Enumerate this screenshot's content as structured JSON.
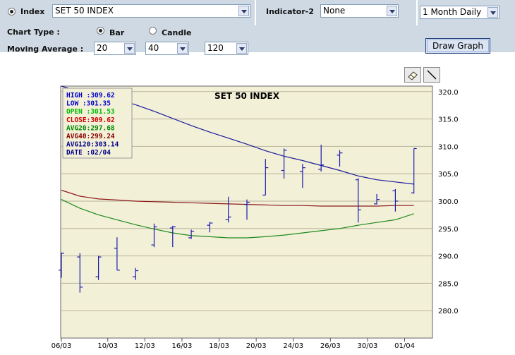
{
  "controls": {
    "index_label": "Index",
    "index_value": "SET 50 INDEX",
    "indicator_label": "Indicator-2",
    "indicator_value": "None",
    "period_value": "1 Month Daily",
    "chart_type_label": "Chart Type :",
    "bar_label": "Bar",
    "candle_label": "Candle",
    "moving_average_label": "Moving Average :",
    "ma_values": [
      "20",
      "40",
      "120"
    ],
    "draw_button": "Draw Graph"
  },
  "tools": [
    "eraser-icon",
    "line-icon"
  ],
  "info_box": [
    {
      "text": "HIGH :309.62",
      "color": "#0000cc"
    },
    {
      "text": "LOW  :301.35",
      "color": "#0000cc"
    },
    {
      "text": "OPEN :301.53",
      "color": "#00bb00"
    },
    {
      "text": "CLOSE:309.62",
      "color": "#cc0000"
    },
    {
      "text": "AVG20:297.68",
      "color": "#008800"
    },
    {
      "text": "AVG40:299.24",
      "color": "#880000"
    },
    {
      "text": "AVG120:303.14",
      "color": "#000088"
    },
    {
      "text": "DATE :02/04",
      "color": "#000088"
    }
  ],
  "chart_data": {
    "type": "bar",
    "title": "SET 50 INDEX",
    "ylim": [
      275,
      321
    ],
    "yticks": [
      "320.0",
      "315.0",
      "310.0",
      "305.0",
      "300.0",
      "295.0",
      "290.0",
      "285.0",
      "280.0"
    ],
    "ytick_values": [
      320,
      315,
      310,
      305,
      300,
      295,
      290,
      285,
      280
    ],
    "xticks": [
      "06/03",
      "10/03",
      "12/03",
      "16/03",
      "18/03",
      "20/03",
      "24/03",
      "26/03",
      "30/03",
      "01/04"
    ],
    "xtick_index": [
      0,
      2.5,
      4.5,
      6.5,
      8.5,
      10.5,
      12.5,
      14.5,
      16.5,
      18.5
    ],
    "ohlc": [
      {
        "h": 290.6,
        "l": 286.0,
        "o": 287.4,
        "c": 290.5
      },
      {
        "h": 290.5,
        "l": 283.3,
        "o": 289.8,
        "c": 284.3
      },
      {
        "h": 290.0,
        "l": 285.6,
        "o": 286.2,
        "c": 289.8
      },
      {
        "h": 293.4,
        "l": 287.4,
        "o": 291.4,
        "c": 287.4
      },
      {
        "h": 287.8,
        "l": 285.6,
        "o": 286.2,
        "c": 287.3
      },
      {
        "h": 295.9,
        "l": 291.6,
        "o": 292.0,
        "c": 295.3
      },
      {
        "h": 295.5,
        "l": 291.6,
        "o": 295.1,
        "c": 295.3
      },
      {
        "h": 294.8,
        "l": 293.1,
        "o": 293.3,
        "c": 294.5
      },
      {
        "h": 296.2,
        "l": 294.3,
        "o": 295.6,
        "c": 296.0
      },
      {
        "h": 300.8,
        "l": 296.1,
        "o": 296.6,
        "c": 297.1
      },
      {
        "h": 300.3,
        "l": 296.6,
        "o": 299.4,
        "c": 299.8
      },
      {
        "h": 307.7,
        "l": 301.1,
        "o": 301.1,
        "c": 306.1
      },
      {
        "h": 309.6,
        "l": 304.1,
        "o": 305.6,
        "c": 309.3
      },
      {
        "h": 306.8,
        "l": 302.4,
        "o": 305.4,
        "c": 306.1
      },
      {
        "h": 310.3,
        "l": 305.4,
        "o": 305.8,
        "c": 306.6
      },
      {
        "h": 309.3,
        "l": 306.3,
        "o": 308.4,
        "c": 308.8
      },
      {
        "h": 304.2,
        "l": 296.1,
        "o": 303.9,
        "c": 298.4
      },
      {
        "h": 301.3,
        "l": 299.4,
        "o": 299.5,
        "c": 300.3
      },
      {
        "h": 302.2,
        "l": 298.1,
        "o": 301.9,
        "c": 300.0
      },
      {
        "h": 309.6,
        "l": 301.4,
        "o": 301.5,
        "c": 309.6
      }
    ],
    "series": [
      {
        "name": "AVG20",
        "color": "#1e8a1e",
        "values": [
          300.3,
          298.7,
          297.5,
          296.6,
          295.7,
          294.9,
          294.2,
          293.7,
          293.5,
          293.3,
          293.3,
          293.5,
          293.8,
          294.2,
          294.6,
          295.0,
          295.6,
          296.1,
          296.6,
          297.7
        ]
      },
      {
        "name": "AVG40",
        "color": "#8c1a1a",
        "values": [
          302.0,
          300.9,
          300.4,
          300.2,
          300.0,
          299.9,
          299.8,
          299.7,
          299.6,
          299.5,
          299.4,
          299.3,
          299.2,
          299.2,
          299.1,
          299.1,
          299.1,
          299.1,
          299.2,
          299.2
        ]
      },
      {
        "name": "AVG120",
        "color": "#1a1a9c",
        "values": [
          321.0,
          320.0,
          319.5,
          318.6,
          317.6,
          316.4,
          315.1,
          313.8,
          312.6,
          311.5,
          310.4,
          309.2,
          308.2,
          307.4,
          306.5,
          305.6,
          304.6,
          303.9,
          303.5,
          303.1
        ]
      }
    ]
  }
}
